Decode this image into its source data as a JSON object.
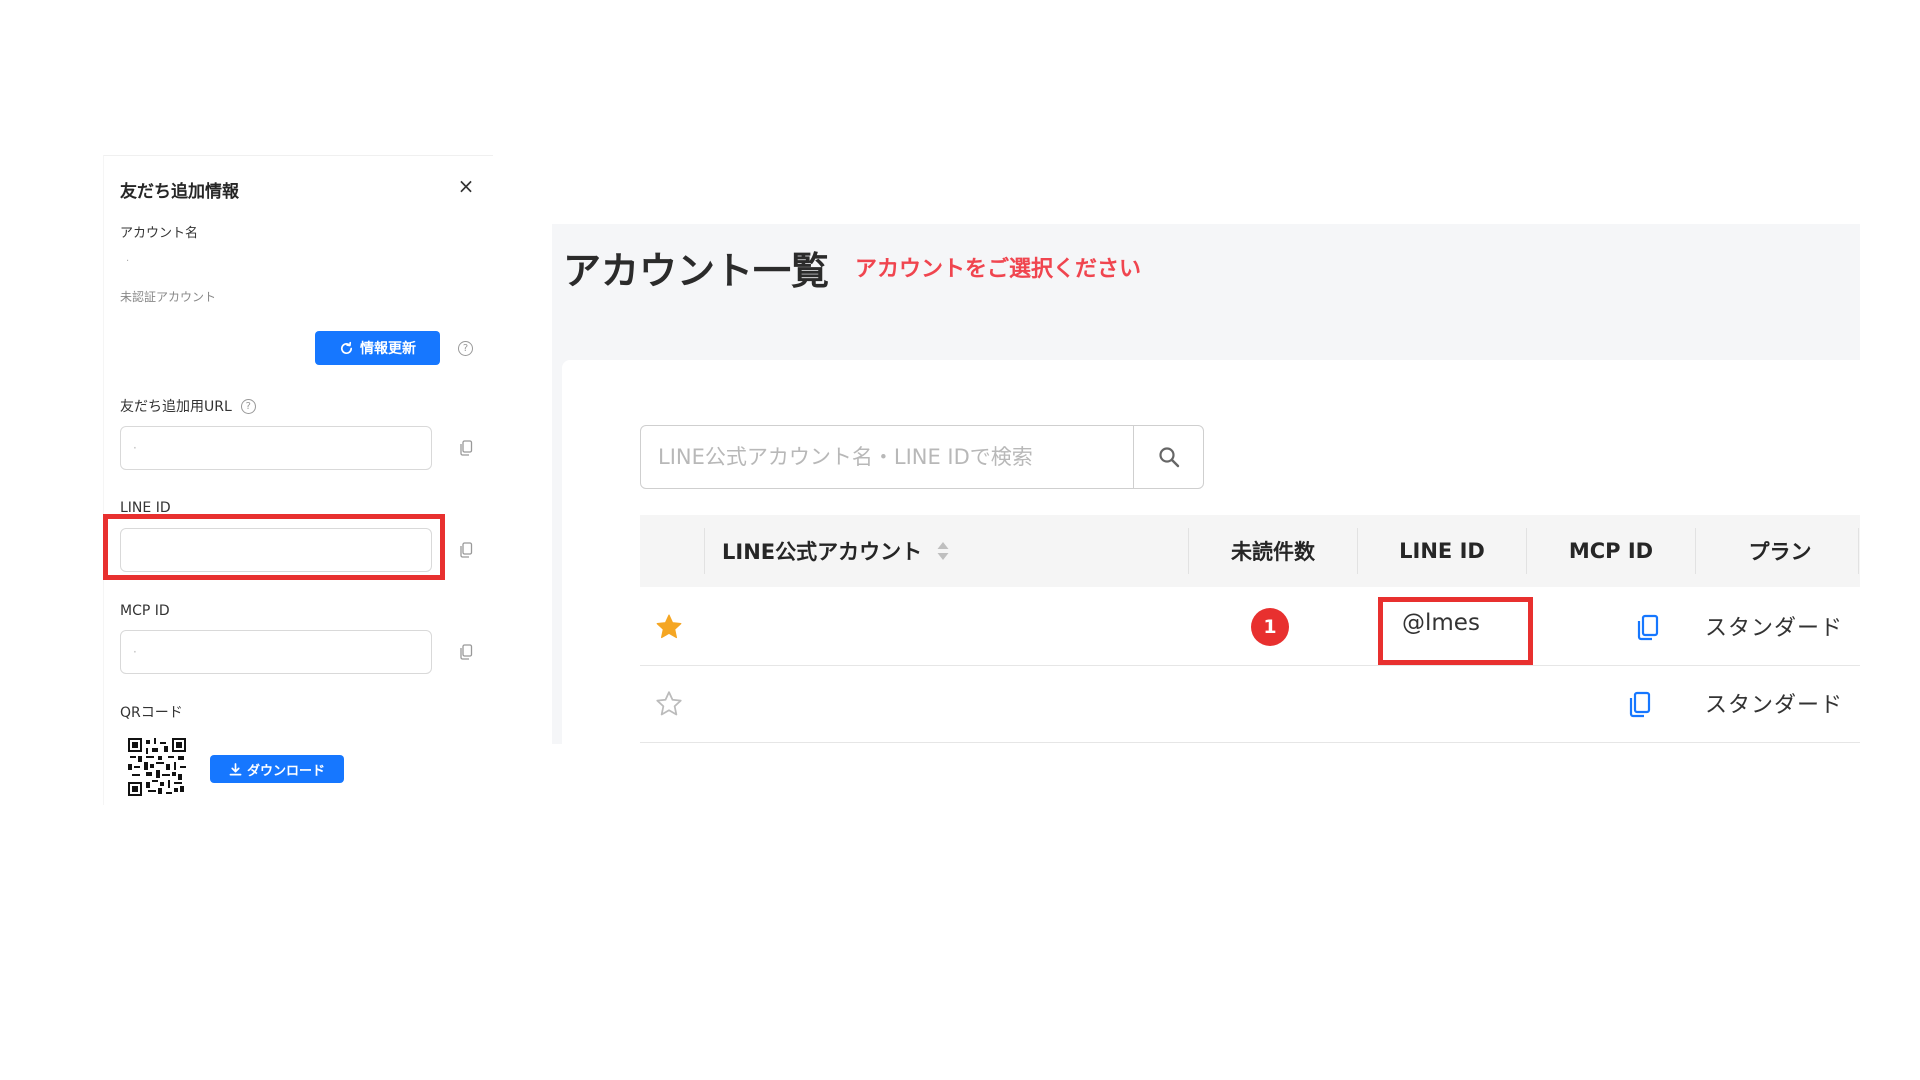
{
  "panel": {
    "title": "友だち追加情報",
    "account_name_label": "アカウント名",
    "account_name_value": "·",
    "status_text": "未認証アカウント",
    "refresh_label": "情報更新",
    "url_label": "友だち追加用URL",
    "url_value": "·",
    "line_id_label": "LINE ID",
    "line_id_value": "",
    "mcp_id_label": "MCP ID",
    "mcp_id_value": "·",
    "qr_label": "QRコード",
    "download_label": "ダウンロード"
  },
  "main": {
    "title": "アカウント一覧",
    "notice": "アカウントをご選択ください",
    "search": {
      "placeholder": "LINE公式アカウント名・LINE IDで検索",
      "value": ""
    },
    "table": {
      "columns": [
        "LINE公式アカウント",
        "未読件数",
        "LINE ID",
        "MCP ID",
        "プラン"
      ],
      "rows": [
        {
          "favorite": true,
          "account": "",
          "unread": "1",
          "line_id": "@lmes",
          "plan": "スタンダード"
        },
        {
          "favorite": false,
          "account": "",
          "unread": "",
          "line_id": "",
          "plan": "スタンダード"
        }
      ]
    }
  },
  "colors": {
    "primary": "#1677ff",
    "highlight": "#e8302f",
    "notice": "#f0454f",
    "star": "#f5a623"
  },
  "icons": {
    "close": "close-icon",
    "refresh": "refresh-icon",
    "help": "help-icon",
    "copy": "copy-icon",
    "search": "search-icon",
    "sort": "sort-icon",
    "star": "star-icon",
    "download": "download-icon",
    "qr": "qr-code-icon"
  }
}
